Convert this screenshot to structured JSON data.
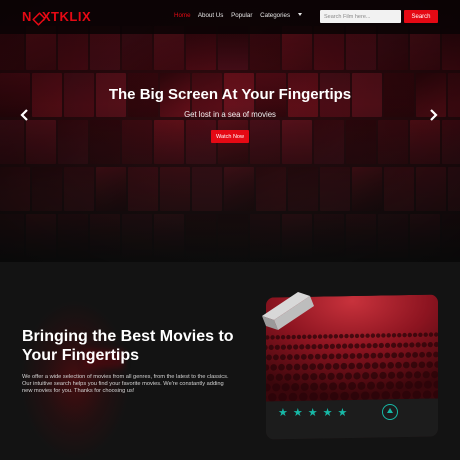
{
  "brand": {
    "logo_before": "N",
    "logo_after": "XTKLIX",
    "accent_color": "#e50914",
    "star_color": "#17b8a6"
  },
  "nav": {
    "links": [
      "Home",
      "About Us",
      "Popular",
      "Categories"
    ],
    "active": "Home"
  },
  "search": {
    "placeholder": "Search Film here...",
    "button_label": "Search"
  },
  "hero": {
    "title": "The Big Screen At Your Fingertips",
    "subtitle": "Get lost in a sea of movies",
    "cta_label": "Watch Now",
    "prev_icon": "chevron-left-icon",
    "next_icon": "chevron-right-icon"
  },
  "about": {
    "title": "Bringing the Best Movies to Your Fingertips",
    "body": "We offer a wide selection of movies from all genres, from the latest to the classics. Our intuitive search helps you find your favorite movies. We're constantly adding new movies for you. Thanks for choosing us!"
  },
  "card": {
    "rating": 5,
    "rating_max": 5,
    "play_icon": "play-icon",
    "ticket_icon": "ticket-icon"
  }
}
